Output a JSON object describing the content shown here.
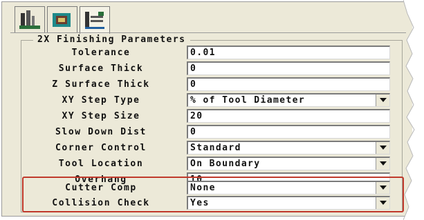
{
  "tabs": [
    {
      "icon": "mill-tool-icon",
      "active": false
    },
    {
      "icon": "part-view-icon",
      "active": false
    },
    {
      "icon": "parameters-icon",
      "active": true
    }
  ],
  "group": {
    "title": "2X Finishing Parameters"
  },
  "params": [
    {
      "label": "Tolerance",
      "value": "0.01",
      "type": "text"
    },
    {
      "label": "Surface Thick",
      "value": "0",
      "type": "text"
    },
    {
      "label": "Z Surface Thick",
      "value": "0",
      "type": "text"
    },
    {
      "label": "XY Step Type",
      "value": "% of Tool Diameter",
      "type": "select"
    },
    {
      "label": "XY Step Size",
      "value": "20",
      "type": "text"
    },
    {
      "label": "Slow Down Dist",
      "value": "0",
      "type": "text"
    },
    {
      "label": "Corner Control",
      "value": "Standard",
      "type": "select"
    },
    {
      "label": "Tool Location",
      "value": "On Boundary",
      "type": "select"
    },
    {
      "label": "Overhang",
      "value": "10",
      "type": "text"
    },
    {
      "label": "Cutter Comp",
      "value": "None",
      "type": "select"
    },
    {
      "label": "Collision Check",
      "value": "Yes",
      "type": "select"
    }
  ],
  "colors": {
    "panel_bg": "#ece9d8",
    "highlight_border": "#c0392b"
  }
}
